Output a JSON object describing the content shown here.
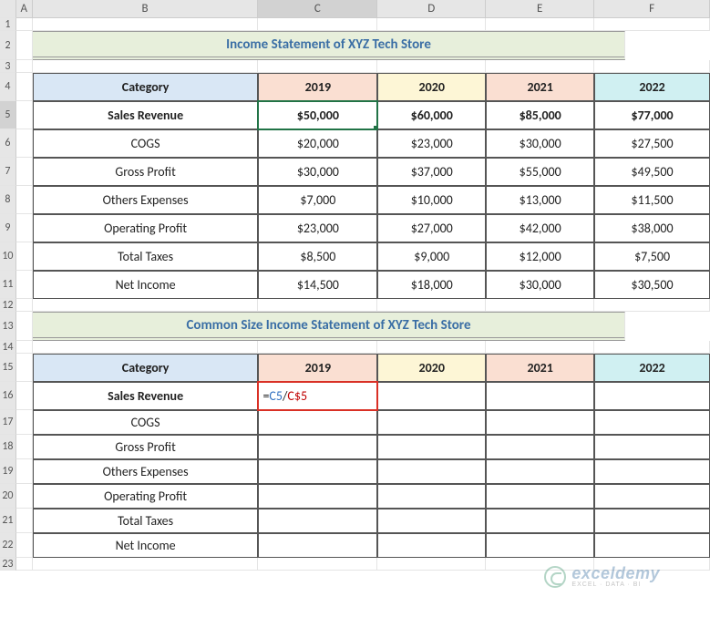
{
  "cols": [
    "A",
    "B",
    "C",
    "D",
    "E",
    "F"
  ],
  "rows": [
    "1",
    "2",
    "3",
    "4",
    "5",
    "6",
    "7",
    "8",
    "9",
    "10",
    "11",
    "12",
    "13",
    "14",
    "15",
    "16",
    "17",
    "18",
    "19",
    "20",
    "21",
    "22",
    "23"
  ],
  "title1": "Income Statement of XYZ Tech Store",
  "title2": "Common Size Income Statement of XYZ Tech Store",
  "headers": {
    "cat": "Category",
    "y19": "2019",
    "y20": "2020",
    "y21": "2021",
    "y22": "2022"
  },
  "t1": {
    "r5": {
      "b": "Sales Revenue",
      "c": "$50,000",
      "d": "$60,000",
      "e": "$85,000",
      "f": "$77,000"
    },
    "r6": {
      "b": "COGS",
      "c": "$20,000",
      "d": "$23,000",
      "e": "$30,000",
      "f": "$27,500"
    },
    "r7": {
      "b": "Gross Profit",
      "c": "$30,000",
      "d": "$37,000",
      "e": "$55,000",
      "f": "$49,500"
    },
    "r8": {
      "b": "Others Expenses",
      "c": "$7,000",
      "d": "$10,000",
      "e": "$13,000",
      "f": "$11,500"
    },
    "r9": {
      "b": "Operating Profit",
      "c": "$23,000",
      "d": "$27,000",
      "e": "$42,000",
      "f": "$38,000"
    },
    "r10": {
      "b": "Total Taxes",
      "c": "$8,500",
      "d": "$9,000",
      "e": "$12,000",
      "f": "$7,500"
    },
    "r11": {
      "b": "Net Income",
      "c": "$14,500",
      "d": "$18,000",
      "e": "$30,000",
      "f": "$30,500"
    }
  },
  "t2": {
    "r16": {
      "b": "Sales Revenue"
    },
    "r17": {
      "b": "COGS"
    },
    "r18": {
      "b": "Gross Profit"
    },
    "r19": {
      "b": "Others Expenses"
    },
    "r20": {
      "b": "Operating Profit"
    },
    "r21": {
      "b": "Total Taxes"
    },
    "r22": {
      "b": "Net Income"
    }
  },
  "formula": {
    "eq": "=",
    "ref1": "C5",
    "slash": "/",
    "ref2": "C$5"
  },
  "watermark": {
    "name": "exceldemy",
    "tag": "EXCEL · DATA · BI"
  }
}
